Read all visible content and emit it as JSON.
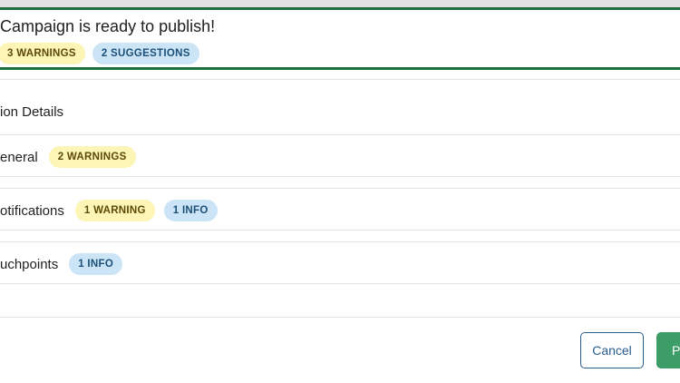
{
  "banner": {
    "title": "Campaign is ready to publish!",
    "warnings_badge": "3 WARNINGS",
    "suggestions_badge": "2 SUGGESTIONS"
  },
  "details": {
    "heading": "ion Details",
    "rows": [
      {
        "label": "eneral",
        "badges": [
          "2 WARNINGS"
        ]
      },
      {
        "label": "otifications",
        "badges": [
          "1 WARNING",
          "1 INFO"
        ]
      },
      {
        "label": "uchpoints",
        "badges": [
          "1 INFO"
        ]
      }
    ]
  },
  "footer": {
    "cancel_label": "Cancel",
    "publish_label": "Pu"
  },
  "colors": {
    "success_border": "#1e6e3e",
    "warning_badge_bg": "#fdf5b5",
    "info_badge_bg": "#cbe5f7",
    "publish_button": "#3d9d67",
    "cancel_button_text": "#2a5d8f"
  }
}
